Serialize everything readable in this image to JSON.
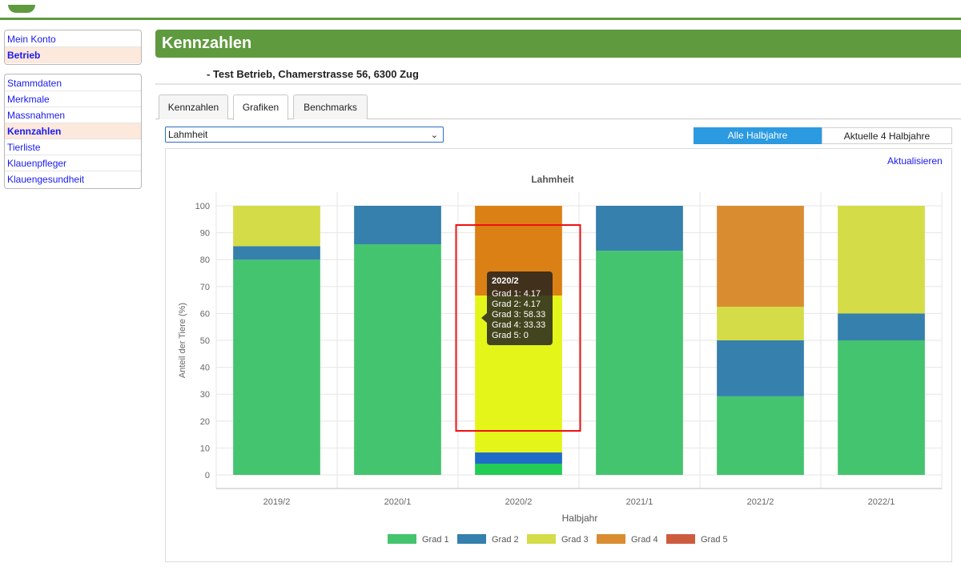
{
  "sidebar": {
    "top_items": [
      {
        "label": "Mein Konto",
        "active": false
      },
      {
        "label": "Betrieb",
        "active": true
      }
    ],
    "nav_items": [
      {
        "label": "Stammdaten",
        "active": false
      },
      {
        "label": "Merkmale",
        "active": false
      },
      {
        "label": "Massnahmen",
        "active": false
      },
      {
        "label": "Kennzahlen",
        "active": true
      },
      {
        "label": "Tierliste",
        "active": false
      },
      {
        "label": "Klauenpfleger",
        "active": false
      },
      {
        "label": "Klauengesundheit",
        "active": false
      }
    ]
  },
  "page": {
    "title": "Kennzahlen",
    "subtitle": "- Test Betrieb, Chamerstrasse 56, 6300 Zug"
  },
  "tabs": [
    {
      "label": "Kennzahlen",
      "active": false
    },
    {
      "label": "Grafiken",
      "active": true
    },
    {
      "label": "Benchmarks",
      "active": false
    }
  ],
  "controls": {
    "metric_select": "Lahmheit",
    "toggle_all": "Alle Halbjahre",
    "toggle_recent": "Aktuelle 4 Halbjahre",
    "refresh": "Aktualisieren"
  },
  "chart_data": {
    "type": "bar",
    "stacked": true,
    "title": "Lahmheit",
    "xlabel": "Halbjahr",
    "ylabel": "Anteil der Tiere (%)",
    "ylim": [
      0,
      100
    ],
    "yticks": [
      0,
      10,
      20,
      30,
      40,
      50,
      60,
      70,
      80,
      90,
      100
    ],
    "grid": true,
    "legend_position": "bottom",
    "categories": [
      "2019/2",
      "2020/1",
      "2020/2",
      "2021/1",
      "2021/2",
      "2022/1"
    ],
    "series": [
      {
        "name": "Grad 1",
        "color": "#44c46e",
        "values": [
          80,
          85.7,
          4.17,
          83.3,
          29.2,
          50
        ]
      },
      {
        "name": "Grad 2",
        "color": "#3580ad",
        "values": [
          5,
          14.3,
          4.17,
          16.7,
          20.8,
          10
        ]
      },
      {
        "name": "Grad 3",
        "color": "#d4dc48",
        "values": [
          15,
          0,
          58.33,
          0,
          12.5,
          40
        ]
      },
      {
        "name": "Grad 4",
        "color": "#d98c30",
        "values": [
          0,
          0,
          33.33,
          0,
          37.5,
          0
        ]
      },
      {
        "name": "Grad 5",
        "color": "#cd5c3f",
        "values": [
          0,
          0,
          0,
          0,
          0,
          0
        ]
      }
    ],
    "highlight": {
      "category": "2020/2",
      "colors": {
        "Grad 1": "#22cc55",
        "Grad 2": "#1f6cc8",
        "Grad 3": "#e4f51a",
        "Grad 4": "#db8015"
      },
      "box_color": "#ee1111"
    },
    "tooltip": {
      "title": "2020/2",
      "lines": [
        "Grad 1: 4.17",
        "Grad 2: 4.17",
        "Grad 3: 58.33",
        "Grad 4: 33.33",
        "Grad 5: 0"
      ]
    }
  }
}
